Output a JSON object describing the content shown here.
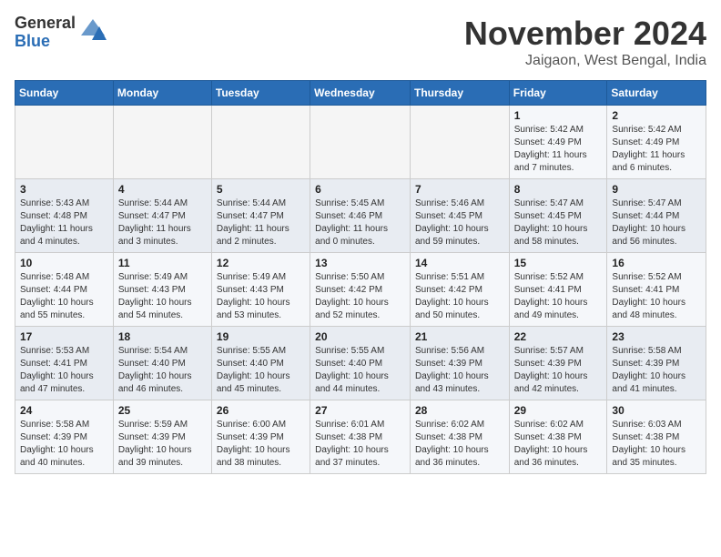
{
  "logo": {
    "general": "General",
    "blue": "Blue"
  },
  "title": "November 2024",
  "location": "Jaigaon, West Bengal, India",
  "days_of_week": [
    "Sunday",
    "Monday",
    "Tuesday",
    "Wednesday",
    "Thursday",
    "Friday",
    "Saturday"
  ],
  "weeks": [
    [
      {
        "day": "",
        "sunrise": "",
        "sunset": "",
        "daylight": ""
      },
      {
        "day": "",
        "sunrise": "",
        "sunset": "",
        "daylight": ""
      },
      {
        "day": "",
        "sunrise": "",
        "sunset": "",
        "daylight": ""
      },
      {
        "day": "",
        "sunrise": "",
        "sunset": "",
        "daylight": ""
      },
      {
        "day": "",
        "sunrise": "",
        "sunset": "",
        "daylight": ""
      },
      {
        "day": "1",
        "sunrise": "Sunrise: 5:42 AM",
        "sunset": "Sunset: 4:49 PM",
        "daylight": "Daylight: 11 hours and 7 minutes."
      },
      {
        "day": "2",
        "sunrise": "Sunrise: 5:42 AM",
        "sunset": "Sunset: 4:49 PM",
        "daylight": "Daylight: 11 hours and 6 minutes."
      }
    ],
    [
      {
        "day": "3",
        "sunrise": "Sunrise: 5:43 AM",
        "sunset": "Sunset: 4:48 PM",
        "daylight": "Daylight: 11 hours and 4 minutes."
      },
      {
        "day": "4",
        "sunrise": "Sunrise: 5:44 AM",
        "sunset": "Sunset: 4:47 PM",
        "daylight": "Daylight: 11 hours and 3 minutes."
      },
      {
        "day": "5",
        "sunrise": "Sunrise: 5:44 AM",
        "sunset": "Sunset: 4:47 PM",
        "daylight": "Daylight: 11 hours and 2 minutes."
      },
      {
        "day": "6",
        "sunrise": "Sunrise: 5:45 AM",
        "sunset": "Sunset: 4:46 PM",
        "daylight": "Daylight: 11 hours and 0 minutes."
      },
      {
        "day": "7",
        "sunrise": "Sunrise: 5:46 AM",
        "sunset": "Sunset: 4:45 PM",
        "daylight": "Daylight: 10 hours and 59 minutes."
      },
      {
        "day": "8",
        "sunrise": "Sunrise: 5:47 AM",
        "sunset": "Sunset: 4:45 PM",
        "daylight": "Daylight: 10 hours and 58 minutes."
      },
      {
        "day": "9",
        "sunrise": "Sunrise: 5:47 AM",
        "sunset": "Sunset: 4:44 PM",
        "daylight": "Daylight: 10 hours and 56 minutes."
      }
    ],
    [
      {
        "day": "10",
        "sunrise": "Sunrise: 5:48 AM",
        "sunset": "Sunset: 4:44 PM",
        "daylight": "Daylight: 10 hours and 55 minutes."
      },
      {
        "day": "11",
        "sunrise": "Sunrise: 5:49 AM",
        "sunset": "Sunset: 4:43 PM",
        "daylight": "Daylight: 10 hours and 54 minutes."
      },
      {
        "day": "12",
        "sunrise": "Sunrise: 5:49 AM",
        "sunset": "Sunset: 4:43 PM",
        "daylight": "Daylight: 10 hours and 53 minutes."
      },
      {
        "day": "13",
        "sunrise": "Sunrise: 5:50 AM",
        "sunset": "Sunset: 4:42 PM",
        "daylight": "Daylight: 10 hours and 52 minutes."
      },
      {
        "day": "14",
        "sunrise": "Sunrise: 5:51 AM",
        "sunset": "Sunset: 4:42 PM",
        "daylight": "Daylight: 10 hours and 50 minutes."
      },
      {
        "day": "15",
        "sunrise": "Sunrise: 5:52 AM",
        "sunset": "Sunset: 4:41 PM",
        "daylight": "Daylight: 10 hours and 49 minutes."
      },
      {
        "day": "16",
        "sunrise": "Sunrise: 5:52 AM",
        "sunset": "Sunset: 4:41 PM",
        "daylight": "Daylight: 10 hours and 48 minutes."
      }
    ],
    [
      {
        "day": "17",
        "sunrise": "Sunrise: 5:53 AM",
        "sunset": "Sunset: 4:41 PM",
        "daylight": "Daylight: 10 hours and 47 minutes."
      },
      {
        "day": "18",
        "sunrise": "Sunrise: 5:54 AM",
        "sunset": "Sunset: 4:40 PM",
        "daylight": "Daylight: 10 hours and 46 minutes."
      },
      {
        "day": "19",
        "sunrise": "Sunrise: 5:55 AM",
        "sunset": "Sunset: 4:40 PM",
        "daylight": "Daylight: 10 hours and 45 minutes."
      },
      {
        "day": "20",
        "sunrise": "Sunrise: 5:55 AM",
        "sunset": "Sunset: 4:40 PM",
        "daylight": "Daylight: 10 hours and 44 minutes."
      },
      {
        "day": "21",
        "sunrise": "Sunrise: 5:56 AM",
        "sunset": "Sunset: 4:39 PM",
        "daylight": "Daylight: 10 hours and 43 minutes."
      },
      {
        "day": "22",
        "sunrise": "Sunrise: 5:57 AM",
        "sunset": "Sunset: 4:39 PM",
        "daylight": "Daylight: 10 hours and 42 minutes."
      },
      {
        "day": "23",
        "sunrise": "Sunrise: 5:58 AM",
        "sunset": "Sunset: 4:39 PM",
        "daylight": "Daylight: 10 hours and 41 minutes."
      }
    ],
    [
      {
        "day": "24",
        "sunrise": "Sunrise: 5:58 AM",
        "sunset": "Sunset: 4:39 PM",
        "daylight": "Daylight: 10 hours and 40 minutes."
      },
      {
        "day": "25",
        "sunrise": "Sunrise: 5:59 AM",
        "sunset": "Sunset: 4:39 PM",
        "daylight": "Daylight: 10 hours and 39 minutes."
      },
      {
        "day": "26",
        "sunrise": "Sunrise: 6:00 AM",
        "sunset": "Sunset: 4:39 PM",
        "daylight": "Daylight: 10 hours and 38 minutes."
      },
      {
        "day": "27",
        "sunrise": "Sunrise: 6:01 AM",
        "sunset": "Sunset: 4:38 PM",
        "daylight": "Daylight: 10 hours and 37 minutes."
      },
      {
        "day": "28",
        "sunrise": "Sunrise: 6:02 AM",
        "sunset": "Sunset: 4:38 PM",
        "daylight": "Daylight: 10 hours and 36 minutes."
      },
      {
        "day": "29",
        "sunrise": "Sunrise: 6:02 AM",
        "sunset": "Sunset: 4:38 PM",
        "daylight": "Daylight: 10 hours and 36 minutes."
      },
      {
        "day": "30",
        "sunrise": "Sunrise: 6:03 AM",
        "sunset": "Sunset: 4:38 PM",
        "daylight": "Daylight: 10 hours and 35 minutes."
      }
    ]
  ]
}
